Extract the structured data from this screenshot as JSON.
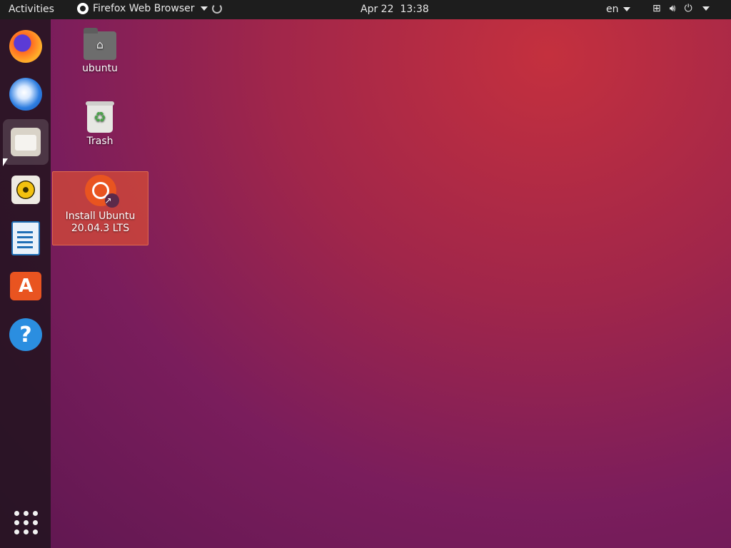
{
  "topbar": {
    "activities": "Activities",
    "app_name": "Firefox Web Browser",
    "date": "Apr 22",
    "time": "13:38",
    "language": "en"
  },
  "dock": {
    "items": [
      {
        "name": "firefox",
        "icon": "firefox-icon"
      },
      {
        "name": "thunderbird",
        "icon": "thunderbird-icon"
      },
      {
        "name": "files",
        "icon": "files-icon",
        "active": true
      },
      {
        "name": "rhythmbox",
        "icon": "rhythmbox-icon"
      },
      {
        "name": "libreoffice-writer",
        "icon": "writer-icon"
      },
      {
        "name": "ubuntu-software",
        "icon": "software-icon"
      },
      {
        "name": "help",
        "icon": "help-icon"
      }
    ],
    "show_apps_icon": "apps-grid-icon"
  },
  "desktop": {
    "home_label": "ubuntu",
    "trash_label": "Trash",
    "install_label_line1": "Install Ubuntu",
    "install_label_line2": "20.04.3 LTS"
  },
  "colors": {
    "accent": "#e95420",
    "topbar_bg": "#1d1d1d",
    "selection": "#d64b37"
  }
}
